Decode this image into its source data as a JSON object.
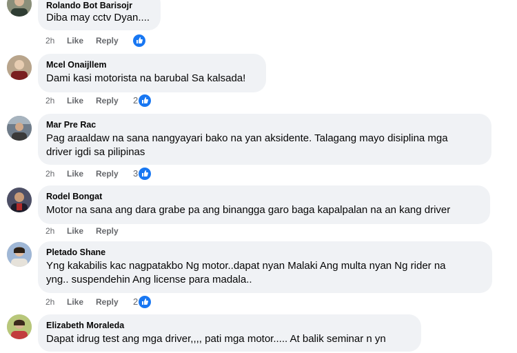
{
  "comments": [
    {
      "name": "Rolando Bot Barisojr",
      "text": "Diba may cctv Dyan....",
      "time": "2h",
      "like_label": "Like",
      "reply_label": "Reply",
      "reactions": ""
    },
    {
      "name": "Mcel Onaijllem",
      "text": "Dami kasi motorista na barubal Sa kalsada!",
      "time": "2h",
      "like_label": "Like",
      "reply_label": "Reply",
      "reactions": "2"
    },
    {
      "name": "Mar Pre Rac",
      "text_line1": "Pag araaldaw na sana nangyayari bako na yan aksidente. Talagang mayo disiplina mga",
      "text_line2": "driver igdi sa pilipinas",
      "time": "2h",
      "like_label": "Like",
      "reply_label": "Reply",
      "reactions": "3"
    },
    {
      "name": "Rodel Bongat",
      "text": "Motor na sana ang dara grabe pa ang binangga garo baga kapalpalan na an kang driver",
      "time": "2h",
      "like_label": "Like",
      "reply_label": "Reply"
    },
    {
      "name": "Pletado Shane",
      "text_line1": "Yng kakabilis kac nagpatakbo Ng motor..dapat nyan Malaki Ang multa nyan Ng rider na",
      "text_line2": "yng.. suspendehin Ang license para madala..",
      "time": "2h",
      "like_label": "Like",
      "reply_label": "Reply",
      "reactions": "2"
    },
    {
      "name": "Elizabeth Moraleda",
      "text": "Dapat idrug test ang mga driver,,,, pati mga motor..... At balik seminar n yn"
    }
  ],
  "icons": {
    "reaction": "like-thumb-icon"
  },
  "colors": {
    "reaction_blue": "#1877f2",
    "bubble": "#f0f2f5",
    "meta": "#65676b"
  }
}
